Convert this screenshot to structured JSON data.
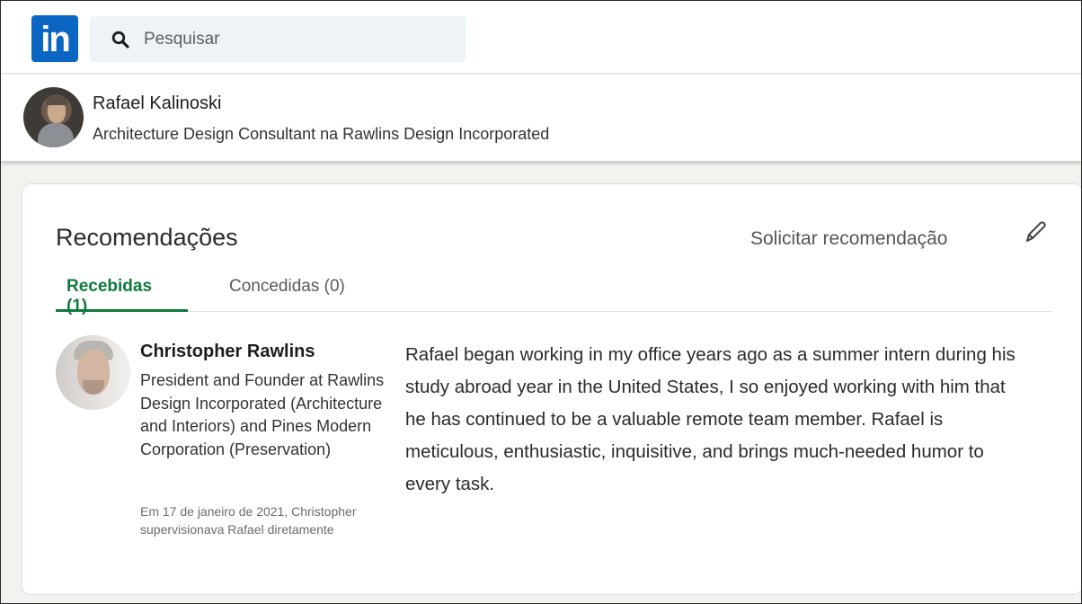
{
  "app": {
    "logo_text": "in",
    "brand_color": "#0a66c2"
  },
  "search": {
    "placeholder": "Pesquisar",
    "icon": "search-icon"
  },
  "profile": {
    "name": "Rafael Kalinoski",
    "headline": "Architecture Design Consultant na Rawlins Design Incorporated"
  },
  "recommendations": {
    "title": "Recomendações",
    "request_label": "Solicitar recomendação",
    "edit_icon": "pencil-icon",
    "tabs": [
      {
        "label": "Recebidas (1)",
        "active": true
      },
      {
        "label": "Concedidas (0)",
        "active": false
      }
    ],
    "accent_color": "#0f7a3d",
    "items": [
      {
        "name": "Christopher Rawlins",
        "title": "President and Founder at Rawlins Design Incorporated (Architecture and Interiors) and Pines Modern Corporation (Preservation)",
        "meta": "Em 17 de janeiro de 2021, Christopher supervisionava Rafael diretamente",
        "text": "Rafael began working in my office years ago as a summer intern during his study abroad year in the United States, I so enjoyed working with him that he has continued to be a valuable remote team member. Rafael is meticulous, enthusiastic, inquisitive, and brings much-needed humor to every task."
      }
    ]
  }
}
